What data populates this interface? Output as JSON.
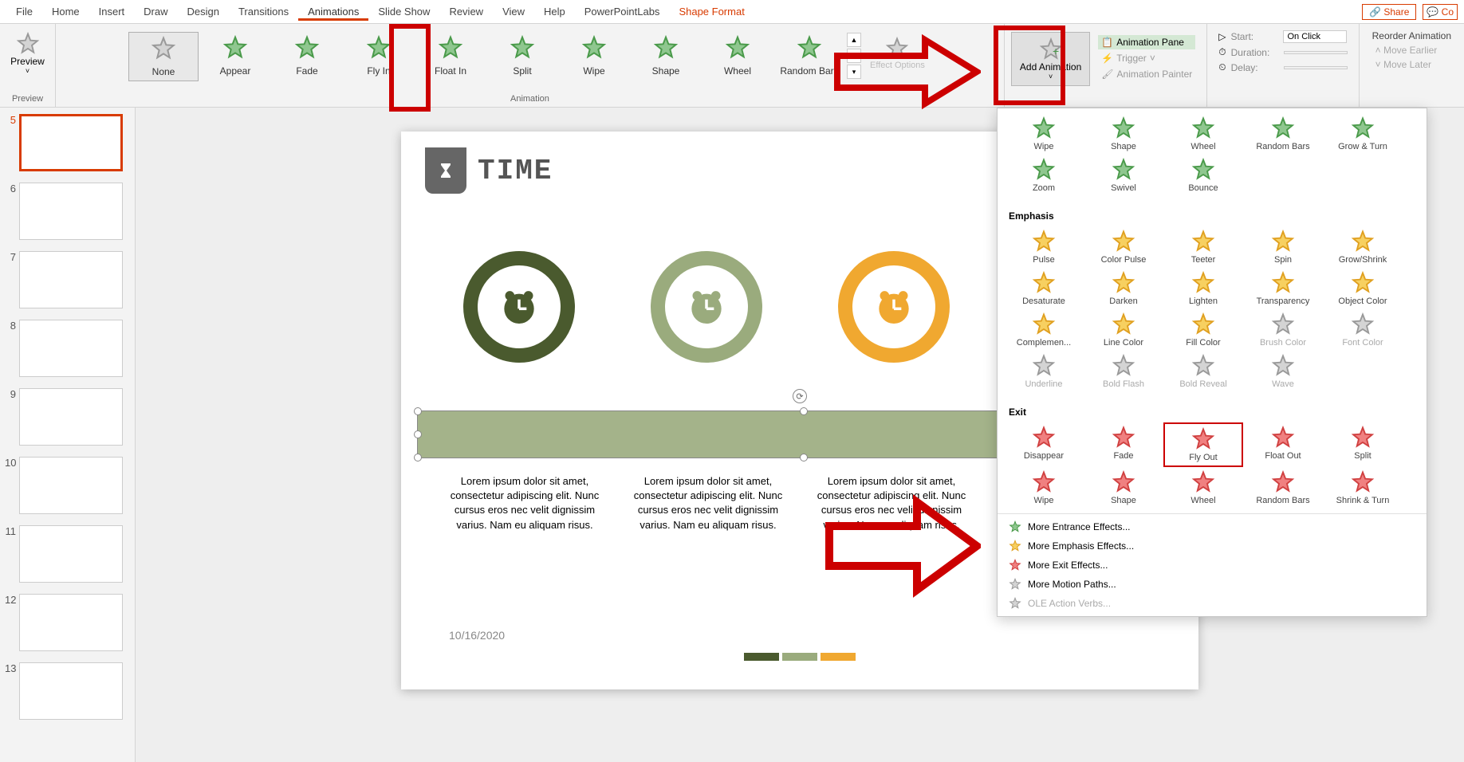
{
  "menubar": {
    "items": [
      "File",
      "Home",
      "Insert",
      "Draw",
      "Design",
      "Transitions",
      "Animations",
      "Slide Show",
      "Review",
      "View",
      "Help",
      "PowerPointLabs",
      "Shape Format"
    ],
    "active": "Animations",
    "share": "Share",
    "comments": "Co"
  },
  "ribbon": {
    "preview_label": "Preview",
    "preview_group": "Preview",
    "gallery": [
      {
        "label": "None",
        "cls": "gray"
      },
      {
        "label": "Appear",
        "cls": "green"
      },
      {
        "label": "Fade",
        "cls": "green"
      },
      {
        "label": "Fly In",
        "cls": "green"
      },
      {
        "label": "Float In",
        "cls": "green"
      },
      {
        "label": "Split",
        "cls": "green"
      },
      {
        "label": "Wipe",
        "cls": "green"
      },
      {
        "label": "Shape",
        "cls": "green"
      },
      {
        "label": "Wheel",
        "cls": "green"
      },
      {
        "label": "Random Bars",
        "cls": "green"
      }
    ],
    "animation_group": "Animation",
    "effect_options": "Effect Options",
    "add_animation": "Add Animation",
    "animation_pane": "Animation Pane",
    "trigger": "Trigger",
    "animation_painter": "Animation Painter",
    "start_label": "Start:",
    "start_value": "On Click",
    "duration_label": "Duration:",
    "delay_label": "Delay:",
    "reorder": "Reorder Animation",
    "move_earlier": "Move Earlier",
    "move_later": "Move Later"
  },
  "thumbs": {
    "numbers": [
      5,
      6,
      7,
      8,
      9,
      10,
      11,
      12,
      13
    ],
    "current": 5
  },
  "slide": {
    "title": "TIME",
    "lorem": "Lorem ipsum dolor sit amet, consectetur adipiscing elit. Nunc cursus eros nec velit dignissim varius. Nam eu aliquam risus.",
    "date": "10/16/2020",
    "tab_colors": [
      "#4a5a2e",
      "#9aab7d",
      "#f0a830"
    ]
  },
  "dropdown": {
    "entrance_extra": [
      "Wipe",
      "Shape",
      "Wheel",
      "Random Bars",
      "Grow & Turn",
      "Zoom",
      "Swivel",
      "Bounce"
    ],
    "emphasis_hdr": "Emphasis",
    "emphasis": [
      {
        "label": "Pulse"
      },
      {
        "label": "Color Pulse"
      },
      {
        "label": "Teeter"
      },
      {
        "label": "Spin"
      },
      {
        "label": "Grow/Shrink"
      },
      {
        "label": "Desaturate"
      },
      {
        "label": "Darken"
      },
      {
        "label": "Lighten"
      },
      {
        "label": "Transparency"
      },
      {
        "label": "Object Color"
      },
      {
        "label": "Complemen..."
      },
      {
        "label": "Line Color"
      },
      {
        "label": "Fill Color"
      },
      {
        "label": "Brush Color",
        "disabled": true
      },
      {
        "label": "Font Color",
        "disabled": true
      },
      {
        "label": "Underline",
        "disabled": true
      },
      {
        "label": "Bold Flash",
        "disabled": true
      },
      {
        "label": "Bold Reveal",
        "disabled": true
      },
      {
        "label": "Wave",
        "disabled": true
      }
    ],
    "exit_hdr": "Exit",
    "exit": [
      {
        "label": "Disappear"
      },
      {
        "label": "Fade"
      },
      {
        "label": "Fly Out",
        "highlighted": true
      },
      {
        "label": "Float Out"
      },
      {
        "label": "Split"
      },
      {
        "label": "Wipe"
      },
      {
        "label": "Shape"
      },
      {
        "label": "Wheel"
      },
      {
        "label": "Random Bars"
      },
      {
        "label": "Shrink & Turn"
      }
    ],
    "links": [
      {
        "label": "More Entrance Effects...",
        "cls": "green"
      },
      {
        "label": "More Emphasis Effects...",
        "cls": "yellow"
      },
      {
        "label": "More Exit Effects...",
        "cls": "red"
      },
      {
        "label": "More Motion Paths...",
        "cls": "gray"
      },
      {
        "label": "OLE Action Verbs...",
        "cls": "gray",
        "disabled": true
      }
    ]
  }
}
